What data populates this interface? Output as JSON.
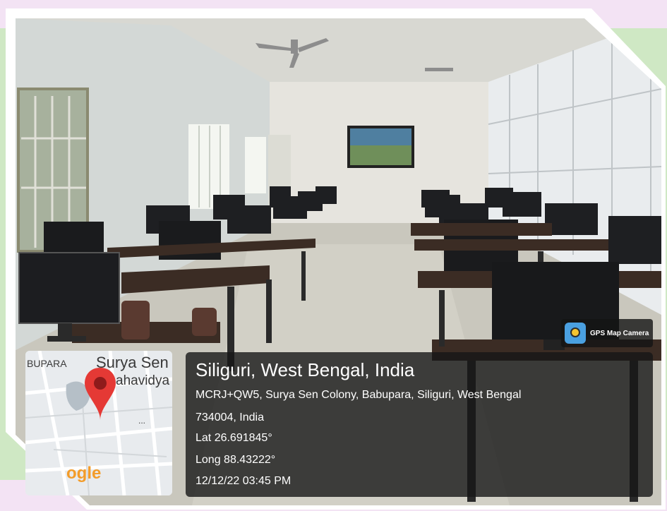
{
  "app": {
    "name": "GPS Map Camera",
    "icon": "gps-map-camera-icon"
  },
  "map": {
    "labels": {
      "area": "BUPARA",
      "place_line1": "Surya Sen",
      "place_line2": "ahavidya",
      "logo": "ogle",
      "dots": "..."
    },
    "pin_color": "#e53935",
    "pin_icon": "map-pin-icon"
  },
  "location": {
    "city": "Siliguri, West Bengal, India",
    "address_line1": "MCRJ+QW5, Surya Sen Colony, Babupara, Siliguri, West Bengal",
    "address_line2": "734004, India",
    "latitude": "Lat 26.691845°",
    "longitude": "Long 88.43222°",
    "datetime": "12/12/22 03:45 PM"
  },
  "colors": {
    "border_pink": "#f3e3f4",
    "border_green": "#cfe8c4",
    "overlay": "#161616"
  }
}
